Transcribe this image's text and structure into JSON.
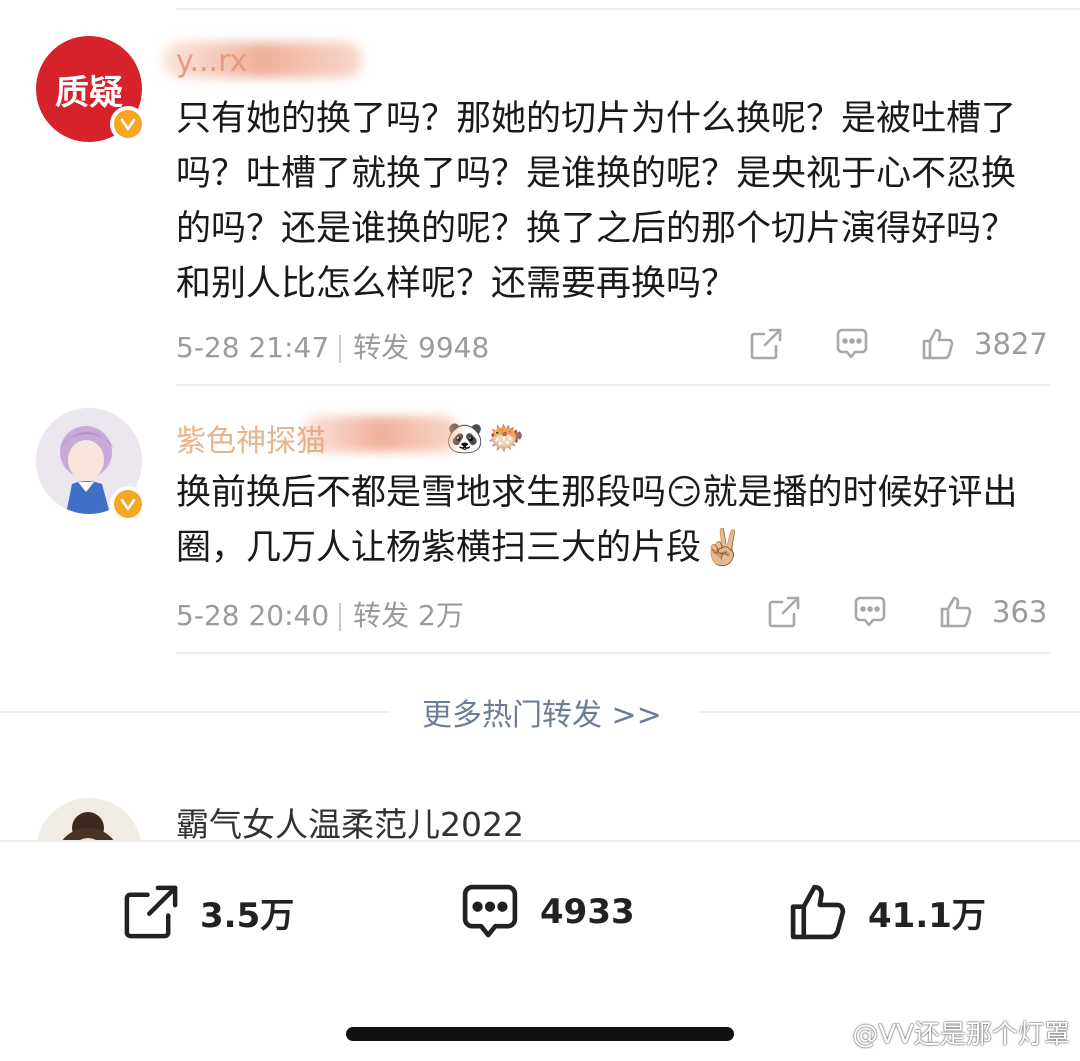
{
  "post1": {
    "avatar_text": "质疑",
    "username": "y...rx",
    "text": "只有她的换了吗？那她的切片为什么换呢？是被吐槽了吗？吐槽了就换了吗？是谁换的呢？是央视于心不忍换的吗？还是谁换的呢？换了之后的那个切片演得好吗？和别人比怎么样呢？还需要再换吗？",
    "time": "5-28 21:47",
    "repost_label": "转发 9948",
    "likes": "3827"
  },
  "post2": {
    "username": "紫色神探猫",
    "text_part1": "换前换后不都是雪地求生那段吗",
    "text_part2": "就是播的时候好评出圈，几万人让杨紫横扫三大的片段",
    "time": "5-28 20:40",
    "repost_label": "转发 2万",
    "likes": "363"
  },
  "more_link": "更多热门转发 >>",
  "next_user": "霸气女人温柔范儿2022",
  "bottom_bar": {
    "reposts": "3.5万",
    "comments": "4933",
    "likes": "41.1万"
  },
  "watermark": "@VV还是那个灯罩",
  "colors": {
    "verified": "#f5a623",
    "link": "#6d7d99",
    "meta": "#9b9b9b",
    "avatar_red": "#d6222a"
  },
  "icons": [
    "share-icon",
    "comment-icon",
    "like-icon",
    "verified-icon",
    "panda-emoji",
    "fish-emoji",
    "smile-emoji",
    "victory-hand-emoji",
    "weibo-logo"
  ]
}
